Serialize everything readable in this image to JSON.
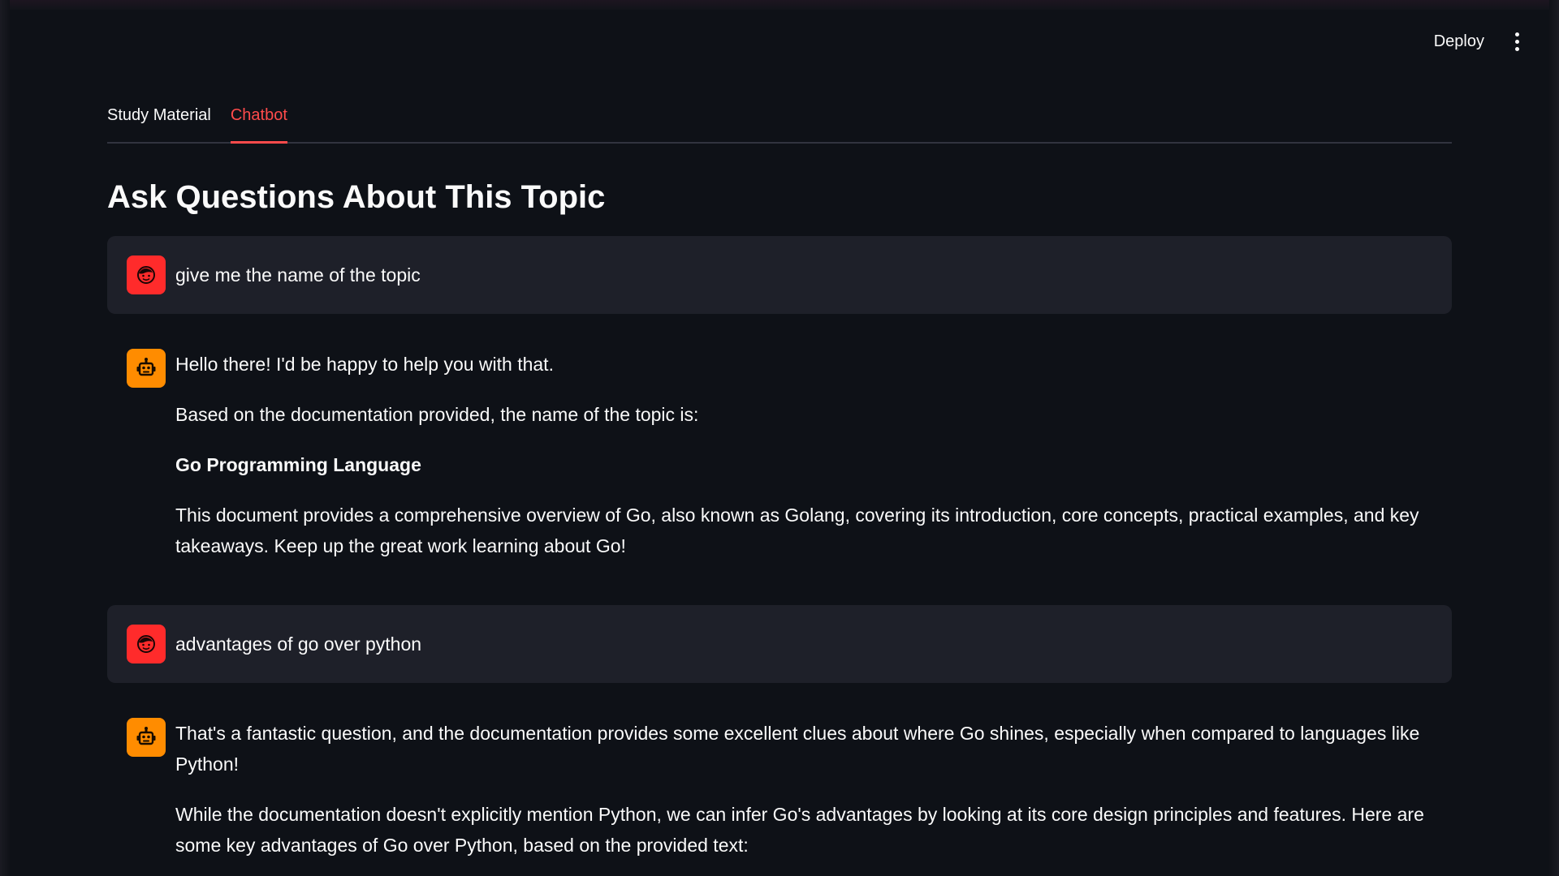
{
  "header": {
    "deploy_label": "Deploy",
    "menu_icon": "more-vert-icon"
  },
  "tabs": [
    {
      "label": "Study Material",
      "active": false
    },
    {
      "label": "Chatbot",
      "active": true
    }
  ],
  "page_title": "Ask Questions About This Topic",
  "messages": [
    {
      "role": "user",
      "icon": "user-face-icon",
      "text": "give me the name of the topic"
    },
    {
      "role": "assistant",
      "icon": "robot-icon",
      "paragraphs": [
        "Hello there! I'd be happy to help you with that.",
        "Based on the documentation provided, the name of the topic is:",
        "Go Programming Language",
        "This document provides a comprehensive overview of Go, also known as Golang, covering its introduction, core concepts, practical examples, and key takeaways. Keep up the great work learning about Go!"
      ]
    },
    {
      "role": "user",
      "icon": "user-face-icon",
      "text": "advantages of go over python"
    },
    {
      "role": "assistant",
      "icon": "robot-icon",
      "paragraphs": [
        "That's a fantastic question, and the documentation provides some excellent clues about where Go shines, especially when compared to languages like Python!",
        "While the documentation doesn't explicitly mention Python, we can infer Go's advantages by looking at its core design principles and features. Here are some key advantages of Go over Python, based on the provided text:"
      ]
    }
  ],
  "colors": {
    "background": "#0e1117",
    "user_bubble": "#1e2029",
    "accent": "#ff4b4b",
    "user_avatar": "#ff2b2b",
    "bot_avatar": "#ff8c00"
  }
}
